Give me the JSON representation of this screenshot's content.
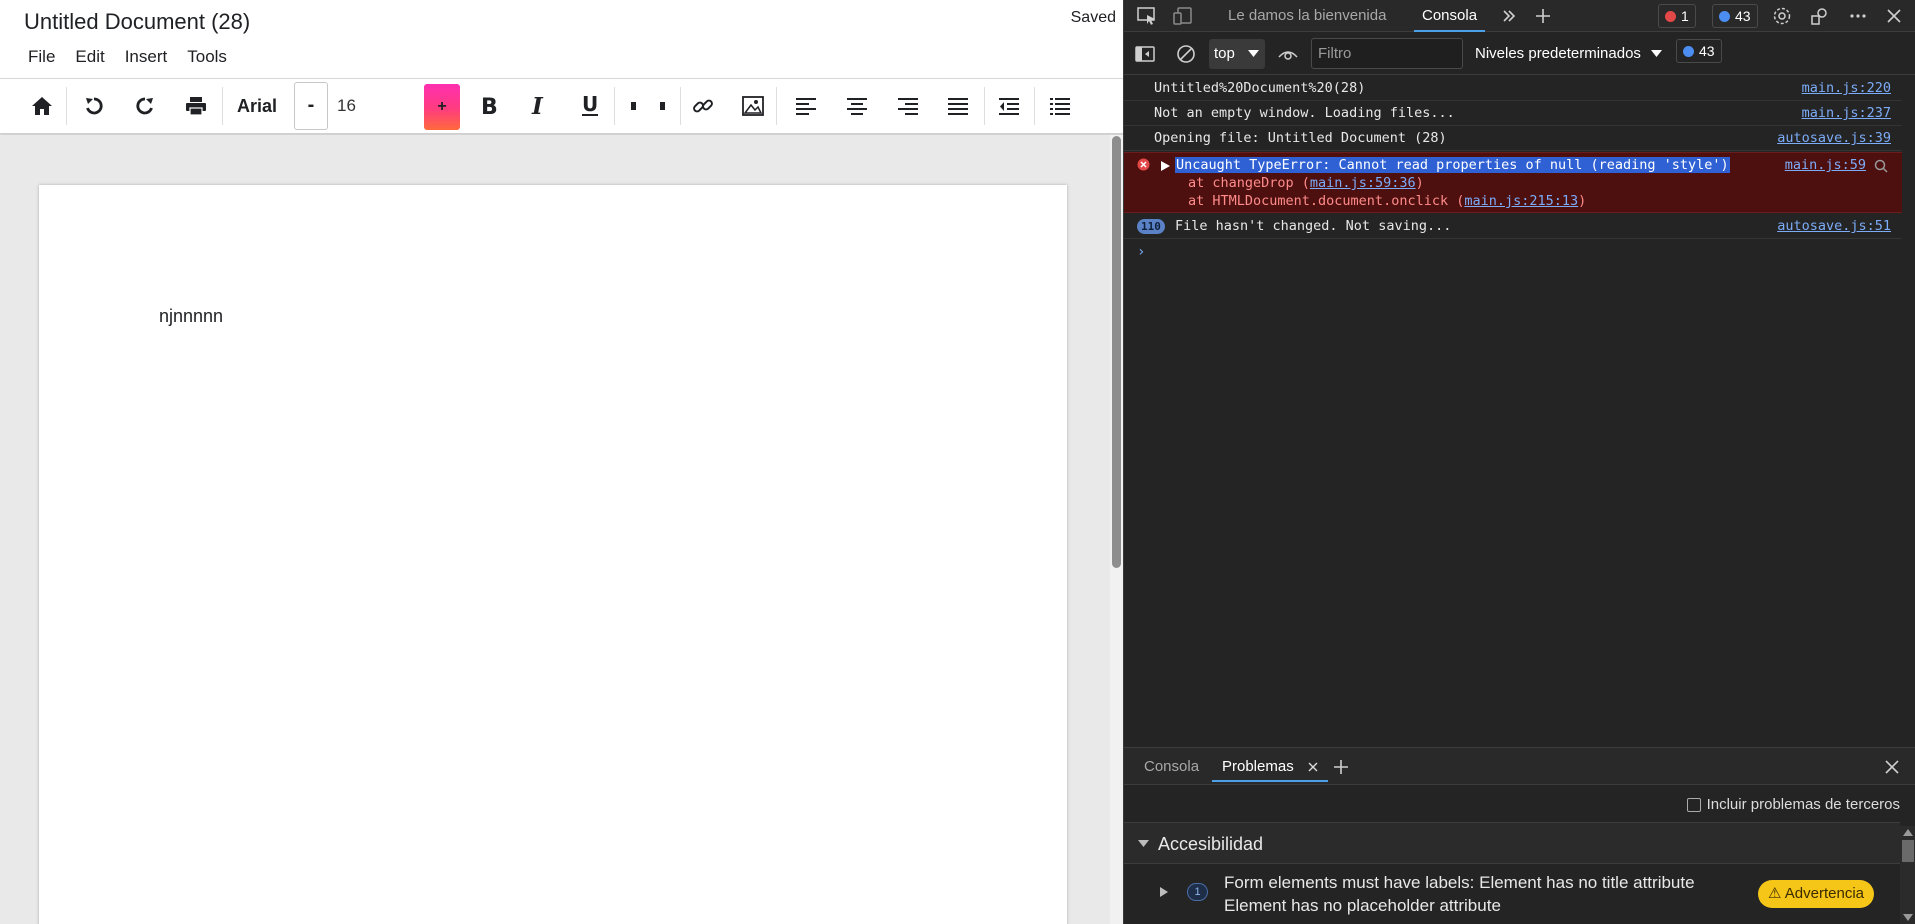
{
  "editor": {
    "title": "Untitled Document (28)",
    "status": "Saved",
    "menu": [
      "File",
      "Edit",
      "Insert",
      "Tools"
    ],
    "toolbar": {
      "font_name": "Arial",
      "size_minus": "-",
      "font_size": "16",
      "size_plus": "+",
      "icons": [
        "home-icon",
        "undo-icon",
        "redo-icon",
        "print-icon",
        "bold-icon",
        "italic-icon",
        "underline-icon",
        "quote-open-icon",
        "quote-close-icon",
        "link-icon",
        "image-icon",
        "align-left-icon",
        "align-center-icon",
        "align-right-icon",
        "justify-icon",
        "outdent-icon",
        "list-icon"
      ],
      "accent": "#ff2fb0"
    },
    "page_text": "njnnnnn"
  },
  "devtools": {
    "tabs": {
      "welcome": "Le damos la bienvenida",
      "console": "Consola"
    },
    "badges": {
      "errors": "1",
      "messages": "43"
    },
    "filterbar": {
      "context": "top",
      "filter_placeholder": "Filtro",
      "levels": "Niveles predeterminados",
      "messages": "43"
    },
    "log": [
      {
        "msg": "Untitled%20Document%20(28)",
        "src": "main.js:220"
      },
      {
        "msg": "Not an empty window. Loading files...",
        "src": "main.js:237"
      },
      {
        "msg": "Opening file: Untitled Document (28)",
        "src": "autosave.js:39"
      }
    ],
    "error": {
      "msg": "Uncaught TypeError: Cannot read properties of null (reading 'style')",
      "src": "main.js:59",
      "stack1_prefix": "at changeDrop (",
      "stack1_link": "main.js:59:36",
      "stack1_suffix": ")",
      "stack2_prefix": "at HTMLDocument.document.onclick (",
      "stack2_link": "main.js:215:13",
      "stack2_suffix": ")"
    },
    "repeat": {
      "count": "110",
      "msg": "File hasn't changed. Not saving...",
      "src": "autosave.js:51"
    },
    "prompt": "›",
    "drawer": {
      "tab_console": "Consola",
      "tab_issues": "Problemas",
      "third_party": "Incluir problemas de terceros",
      "category": "Accesibilidad",
      "issue_count": "1",
      "issue_line1": "Form elements must have labels: Element has no title attribute",
      "issue_line2": "Element has no placeholder attribute",
      "issue_badge": "⚠ Advertencia"
    },
    "colors": {
      "error_bg": "#4e0f0f",
      "link": "#7cacf8",
      "warning": "#f5c518",
      "selection": "#2f61d4"
    }
  }
}
